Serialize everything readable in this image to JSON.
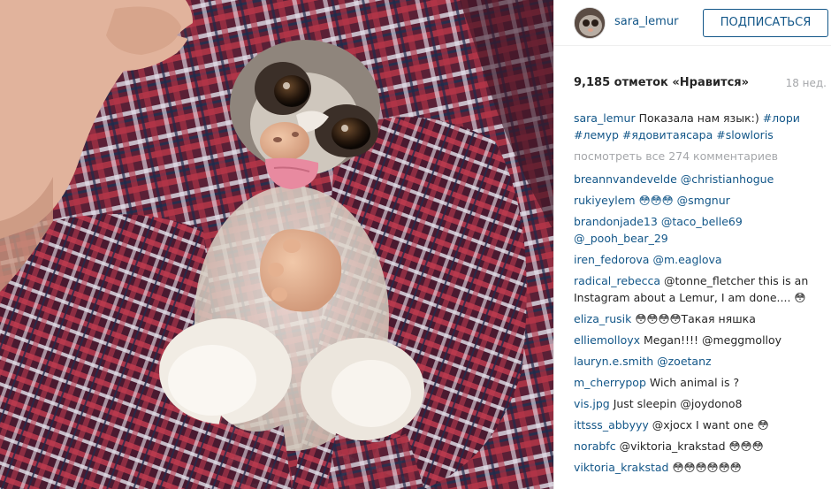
{
  "post": {
    "username": "sara_lemur",
    "follow_label": "ПОДПИСАТЬСЯ",
    "likes": "9,185 отметок «Нравится»",
    "time_ago": "18 нед.",
    "caption_text": "Показала нам язык:)",
    "caption_tags": "#лори #лемур #ядовитаясара #slowloris",
    "view_all": "посмотреть все 274 комментариев"
  },
  "comments": [
    {
      "user": "breannvandevelde",
      "text": "@christianhogue",
      "mention": true
    },
    {
      "user": "rukiyeylem",
      "text": "😳😳😳 @smgnur",
      "mention": true
    },
    {
      "user": "brandonjade13",
      "text": "@taco_belle69 @_pooh_bear_29",
      "mention": true
    },
    {
      "user": "iren_fedorova",
      "text": "@m.eaglova",
      "mention": true
    },
    {
      "user": "radical_rebecca",
      "text": "@tonne_fletcher this is an Instagram about a Lemur, I am done.... 😳",
      "mention": false
    },
    {
      "user": "eliza_rusik",
      "text": "😳😳😳😳Такая няшка",
      "mention": false
    },
    {
      "user": "elliemolloyx",
      "text": "Megan!!!! @meggmolloy",
      "mention": false
    },
    {
      "user": "lauryn.e.smith",
      "text": "@zoetanz",
      "mention": true
    },
    {
      "user": "m_cherrypop",
      "text": "Wich animal is ?",
      "mention": false
    },
    {
      "user": "vis.jpg",
      "text": "Just sleepin @joydono8",
      "mention": false
    },
    {
      "user": "ittsss_abbyyy",
      "text": "@xjocx I want one 😳",
      "mention": false
    },
    {
      "user": "norabfc",
      "text": "@viktoria_krakstad 😳😳😳",
      "mention": false
    },
    {
      "user": "viktoria_krakstad",
      "text": "😳😳😳😳😳😳",
      "mention": false
    }
  ],
  "colors": {
    "link": "#125688",
    "text": "#262626",
    "muted": "#a5a7aa"
  }
}
